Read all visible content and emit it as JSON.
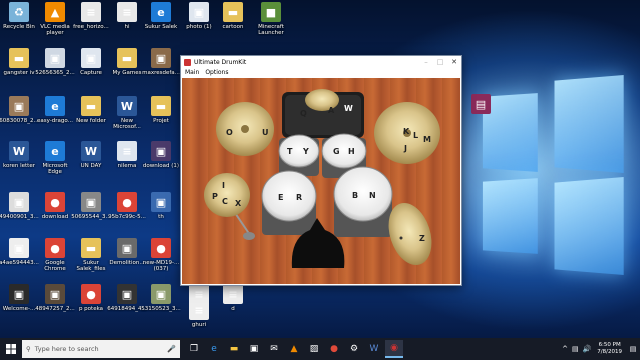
{
  "desktop_icons": [
    {
      "label": "Recycle Bin",
      "icon": "recycle-bin-icon",
      "color": "#7ab3d9"
    },
    {
      "label": "VLC media player",
      "icon": "vlc-icon",
      "color": "#f08a00"
    },
    {
      "label": "free_horizo...",
      "icon": "document-icon",
      "color": "#e8e8e8"
    },
    {
      "label": "hi",
      "icon": "document-icon",
      "color": "#e8e8e8"
    },
    {
      "label": "Sukur Salek",
      "icon": "edge-icon",
      "color": "#1e7bd6"
    },
    {
      "label": "photo (1)",
      "icon": "image-icon",
      "color": "#dfe6ef"
    },
    {
      "label": "cartoon",
      "icon": "folder-icon",
      "color": "#e6c25a"
    },
    {
      "label": "Minecraft Launcher",
      "icon": "minecraft-icon",
      "color": "#5a8f3a"
    },
    {
      "label": "gangster iv",
      "icon": "folder-icon",
      "color": "#e6c25a"
    },
    {
      "label": "52656365_2...",
      "icon": "image-icon",
      "color": "#cfd8e3"
    },
    {
      "label": "Capture",
      "icon": "image-icon",
      "color": "#dfe6ef"
    },
    {
      "label": "My Games",
      "icon": "folder-icon",
      "color": "#e6c25a"
    },
    {
      "label": "maxresdefa...",
      "icon": "image-icon",
      "color": "#8a6a4a"
    },
    {
      "label": "60830078_2...",
      "icon": "image-icon",
      "color": "#9a7a5a"
    },
    {
      "label": "easy-drago...",
      "icon": "edge-icon",
      "color": "#1e7bd6"
    },
    {
      "label": "New folder",
      "icon": "folder-icon",
      "color": "#e6c25a"
    },
    {
      "label": "New Microsof...",
      "icon": "word-icon",
      "color": "#2b5797"
    },
    {
      "label": "Projet",
      "icon": "folder-icon",
      "color": "#e6c25a"
    },
    {
      "label": "koren letter",
      "icon": "word-icon",
      "color": "#2b5797"
    },
    {
      "label": "Microsoft Edge",
      "icon": "edge-icon",
      "color": "#1e7bd6"
    },
    {
      "label": "UN DAY",
      "icon": "word-icon",
      "color": "#2b5797"
    },
    {
      "label": "nilema",
      "icon": "document-icon",
      "color": "#dfe6ef"
    },
    {
      "label": "download (1)",
      "icon": "image-icon",
      "color": "#4a3a6a"
    },
    {
      "label": "49400901_3...",
      "icon": "image-icon",
      "color": "#ddd"
    },
    {
      "label": "download",
      "icon": "chrome-icon",
      "color": "#db4437"
    },
    {
      "label": "50695544_3...",
      "icon": "image-icon",
      "color": "#888"
    },
    {
      "label": "95b7c99c-5...",
      "icon": "chrome-icon",
      "color": "#db4437"
    },
    {
      "label": "th",
      "icon": "image-icon",
      "color": "#3a6ab0"
    },
    {
      "label": "a4ae594443...",
      "icon": "image-icon",
      "color": "#eee"
    },
    {
      "label": "Google Chrome",
      "icon": "chrome-icon",
      "color": "#db4437"
    },
    {
      "label": "Sukur Salek_files",
      "icon": "folder-icon",
      "color": "#e6c25a"
    },
    {
      "label": "Demolition...",
      "icon": "image-icon",
      "color": "#6a6a6a"
    },
    {
      "label": "new-MD19-... (037)",
      "icon": "chrome-icon",
      "color": "#db4437"
    },
    {
      "label": "Welcome-...",
      "icon": "image-icon",
      "color": "#2a2a2a"
    },
    {
      "label": "48947257_2...",
      "icon": "image-icon",
      "color": "#5a4a3a"
    },
    {
      "label": "p poteka",
      "icon": "chrome-icon",
      "color": "#db4437"
    },
    {
      "label": "64918494_4...",
      "icon": "image-icon",
      "color": "#333"
    },
    {
      "label": "53150523_3...",
      "icon": "image-icon",
      "color": "#8a9a6a"
    },
    {
      "label": "",
      "icon": "document-icon",
      "color": "#eee"
    },
    {
      "label": "ghuri",
      "icon": "document-icon",
      "color": "#eee"
    },
    {
      "label": "d",
      "icon": "document-icon",
      "color": "#eee"
    },
    {
      "label": "",
      "icon": "winrar-icon",
      "color": "#8a2a5a"
    }
  ],
  "app_window": {
    "title": "Ultimate DrumKit",
    "menu": [
      "Main",
      "Options"
    ],
    "minimize": "–",
    "maximize": "□",
    "close": "✕",
    "key_labels": {
      "crash_left": [
        "O",
        "U"
      ],
      "hihat_top": [
        "Q",
        "A"
      ],
      "hihat_top_w": "W",
      "ride_right": [
        "K",
        "L",
        "M",
        "J"
      ],
      "tom_left": [
        "T",
        "Y"
      ],
      "tom_right": [
        "G",
        "H"
      ],
      "hihat_left": [
        "I",
        "P",
        "C",
        "X"
      ],
      "floor_left": [
        "E",
        "R"
      ],
      "floor_right": [
        "B",
        "N"
      ],
      "splash_right": "Z"
    }
  },
  "taskbar": {
    "search_placeholder": "Type here to search",
    "time": "6:50 PM",
    "date": "7/8/2019",
    "apps": [
      "task-view-icon",
      "edge-icon",
      "file-explorer-icon",
      "store-icon",
      "mail-icon",
      "vlc-icon",
      "photos-icon",
      "chrome-icon",
      "settings-icon",
      "word-icon",
      "drumkit-icon"
    ]
  },
  "colors": {
    "taskbar": "#161b26",
    "accent": "#76b9ed",
    "wood": "#b35a2c"
  }
}
